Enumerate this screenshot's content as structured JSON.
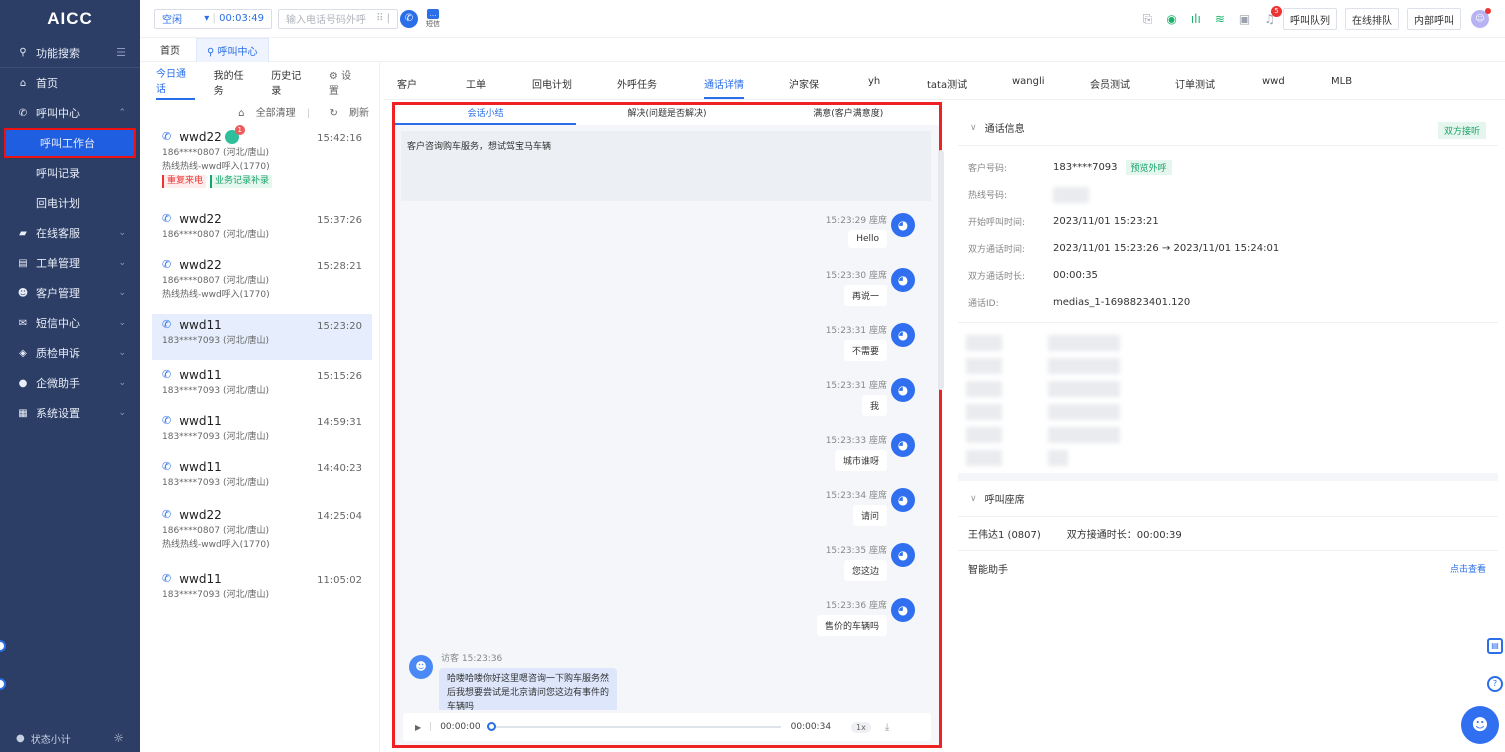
{
  "app": {
    "logo": "AICC"
  },
  "sidebar": {
    "search": "功能搜索",
    "items": [
      {
        "label": "首页",
        "icon": "home-icon",
        "glyph": "⌂"
      },
      {
        "label": "呼叫中心",
        "icon": "phone-icon",
        "glyph": "✆",
        "expanded": true
      },
      {
        "label": "呼叫工作台",
        "sub": true,
        "active": true
      },
      {
        "label": "呼叫记录",
        "sub": true
      },
      {
        "label": "回电计划",
        "sub": true
      },
      {
        "label": "在线客服",
        "icon": "chat-icon",
        "glyph": "▰"
      },
      {
        "label": "工单管理",
        "icon": "ticket-icon",
        "glyph": "▤"
      },
      {
        "label": "客户管理",
        "icon": "users-icon",
        "glyph": "☻"
      },
      {
        "label": "短信中心",
        "icon": "sms-icon",
        "glyph": "✉"
      },
      {
        "label": "质检申诉",
        "icon": "shield-icon",
        "glyph": "◈"
      },
      {
        "label": "企微助手",
        "icon": "wecom-icon",
        "glyph": "●"
      },
      {
        "label": "系统设置",
        "icon": "grid-icon",
        "glyph": "▦"
      }
    ],
    "status": "状态小计"
  },
  "topbar": {
    "status": "空闲",
    "timer": "00:03:49",
    "phone_placeholder": "输入电话号码外呼",
    "sms_label": "短信",
    "notif_count": "5",
    "buttons": [
      "呼叫队列",
      "在线排队",
      "内部呼叫"
    ]
  },
  "navtabs": [
    "首页",
    "呼叫中心"
  ],
  "list": {
    "tabs": [
      "今日通话",
      "我的任务",
      "历史记录",
      "设置"
    ],
    "clear_all": "全部清理",
    "refresh": "刷新",
    "calls": [
      {
        "name": "wwd22",
        "time": "15:42:16",
        "phone": "186****0807 (河北/唐山)",
        "line": "热线热线-wwd呼入(1770)",
        "tags": [
          "重复来电",
          "业务记录补录"
        ],
        "badge": "1"
      },
      {
        "name": "wwd22",
        "time": "15:37:26",
        "phone": "186****0807 (河北/唐山)",
        "line": "",
        "tags": []
      },
      {
        "name": "wwd22",
        "time": "15:28:21",
        "phone": "186****0807 (河北/唐山)",
        "line": "热线热线-wwd呼入(1770)",
        "tags": []
      },
      {
        "name": "wwd11",
        "time": "15:23:20",
        "phone": "183****7093 (河北/唐山)",
        "line": "",
        "tags": [],
        "selected": true
      },
      {
        "name": "wwd11",
        "time": "15:15:26",
        "phone": "183****7093 (河北/唐山)",
        "line": "",
        "tags": []
      },
      {
        "name": "wwd11",
        "time": "14:59:31",
        "phone": "183****7093 (河北/唐山)",
        "line": "",
        "tags": []
      },
      {
        "name": "wwd11",
        "time": "14:40:23",
        "phone": "183****7093 (河北/唐山)",
        "line": "",
        "tags": []
      },
      {
        "name": "wwd22",
        "time": "14:25:04",
        "phone": "186****0807 (河北/唐山)",
        "line": "热线热线-wwd呼入(1770)",
        "tags": []
      },
      {
        "name": "wwd11",
        "time": "11:05:02",
        "phone": "183****7093 (河北/唐山)",
        "line": "",
        "tags": []
      }
    ]
  },
  "center": {
    "tabs": [
      "客户",
      "工单",
      "回电计划",
      "外呼任务",
      "通话详情",
      "沪家保",
      "yh",
      "tata测试",
      "wangli",
      "会员测试",
      "订单测试",
      "wwd",
      "MLB"
    ],
    "active_tab": "通话详情",
    "subtabs": [
      "会话小结",
      "解决(问题是否解决)",
      "满意(客户满意度)"
    ],
    "summary": "客户咨询购车服务，想试驾宝马车辆",
    "messages": [
      {
        "time": "15:23:29 座席",
        "text": "Hello"
      },
      {
        "time": "15:23:30 座席",
        "text": "再说一"
      },
      {
        "time": "15:23:31 座席",
        "text": "不需要"
      },
      {
        "time": "15:23:31 座席",
        "text": "我"
      },
      {
        "time": "15:23:33 座席",
        "text": "城市谁呀"
      },
      {
        "time": "15:23:34 座席",
        "text": "请问"
      },
      {
        "time": "15:23:35 座席",
        "text": "您这边"
      },
      {
        "time": "15:23:36 座席",
        "text": "售价的车辆吗"
      }
    ],
    "visitor": {
      "time": "访客 15:23:36",
      "text": "哈喽哈喽你好这里嗯咨询一下购车服务然后我想要尝试是北京请问您这边有事件的车辆吗"
    },
    "player": {
      "current": "00:00:00",
      "total": "00:00:34",
      "speed": "1x",
      "progress": 0
    }
  },
  "right": {
    "info_title": "通话信息",
    "both_tag": "双方接听",
    "rows": [
      {
        "k": "客户号码:",
        "v": "183****7093",
        "tag": "预览外呼"
      },
      {
        "k": "热线号码:",
        "v": ""
      },
      {
        "k": "开始呼叫时间:",
        "v": "2023/11/01 15:23:21"
      },
      {
        "k": "双方通话时间:",
        "v": "2023/11/01 15:23:26 → 2023/11/01 15:24:01"
      },
      {
        "k": "双方通话时长:",
        "v": "00:00:35"
      },
      {
        "k": "通话ID:",
        "v": "medias_1-1698823401.120"
      }
    ],
    "agent_title": "呼叫座席",
    "agent_name": "王伟达1 (0807)",
    "agent_duration": "双方接通时长：00:00:39",
    "smart_title": "智能助手",
    "smart_link": "点击查看"
  }
}
